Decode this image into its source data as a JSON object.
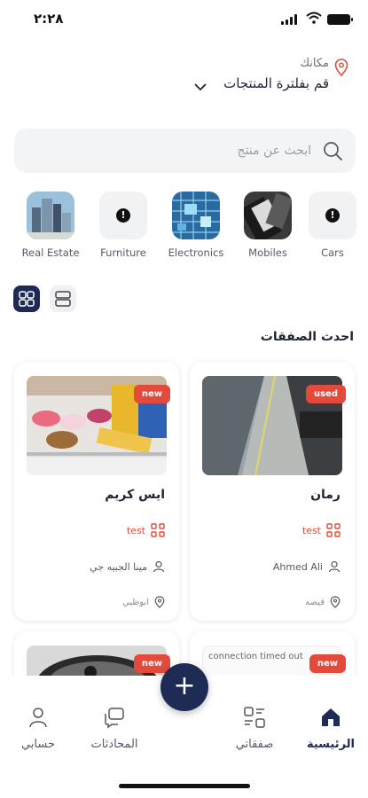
{
  "status_bar": {
    "time": "٢:٢٨"
  },
  "location": {
    "label": "مكانك",
    "value": "قم بفلترة المنتجات"
  },
  "search": {
    "placeholder": "ابحث عن منتج"
  },
  "categories": [
    {
      "name": "Real Estate",
      "icon": "buildings-photo"
    },
    {
      "name": "Furniture",
      "icon": "exclamation-icon"
    },
    {
      "name": "Electronics",
      "icon": "circuit-board-photo"
    },
    {
      "name": "Mobiles",
      "icon": "phone-photo"
    },
    {
      "name": "Cars",
      "icon": "exclamation-icon"
    }
  ],
  "section": {
    "title": "احدث الصفقات"
  },
  "listings": [
    {
      "badge": "used",
      "title": "رمان",
      "condition": "test",
      "seller": "Ahmed Ali",
      "location": "قيصه"
    },
    {
      "badge": "new",
      "title": "ايس كريم",
      "condition": "test",
      "seller": "مينا الجبيه جي",
      "location": "ابوظبي"
    },
    {
      "badge": "new",
      "error_text": "connection timed out"
    },
    {
      "badge": "new"
    }
  ],
  "nav": {
    "home": "الرئيسية",
    "deals": "صفقاتي",
    "chats": "المحادثات",
    "account": "حسابي",
    "add": "+"
  },
  "colors": {
    "primary": "#1d2b55",
    "badge": "#e34a3b",
    "accent_red": "#e34a3b"
  }
}
